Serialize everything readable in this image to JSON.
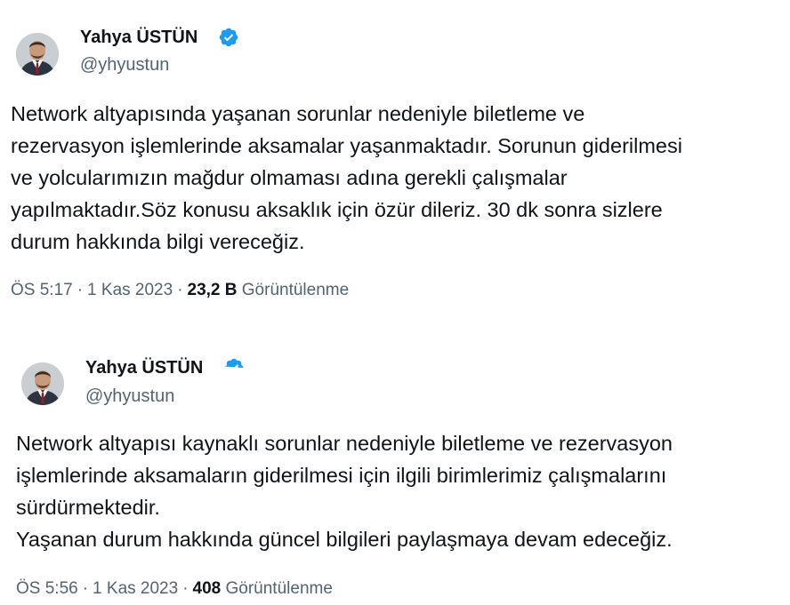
{
  "colors": {
    "text_primary": "#0f1419",
    "text_secondary": "#536471",
    "verified": "#1d9bf0",
    "background": "#ffffff"
  },
  "tweets": [
    {
      "author": {
        "name": "Yahya ÜSTÜN",
        "handle": "@yhyustun",
        "verified_icon": "verified-badge-icon",
        "avatar_icon": "avatar-photo"
      },
      "text": "Network altyapısında yaşanan sorunlar nedeniyle biletleme ve\nrezervasyon işlemlerinde aksamalar yaşanmaktadır. Sorunun giderilmesi\nve yolcularımızın mağdur olmaması adına gerekli çalışmalar\nyapılmaktadır.Söz konusu  aksaklık için özür dileriz. 30 dk sonra sizlere\ndurum hakkında bilgi vereceğiz.",
      "time": "ÖS 5:17",
      "date": "1 Kas 2023",
      "views": "23,2 B",
      "views_label": "Görüntülenme"
    },
    {
      "author": {
        "name": "Yahya ÜSTÜN",
        "handle": "@yhyustun",
        "verified_icon": "verified-badge-icon",
        "avatar_icon": "avatar-photo"
      },
      "text": "Network altyapısı kaynaklı sorunlar nedeniyle biletleme ve rezervasyon\nişlemlerinde aksamaların giderilmesi için ilgili birimlerimiz çalışmalarını\nsürdürmektedir.\nYaşanan durum hakkında güncel bilgileri paylaşmaya devam edeceğiz.",
      "time": "ÖS 5:56",
      "date": "1 Kas 2023",
      "views": "408",
      "views_label": "Görüntülenme"
    }
  ]
}
